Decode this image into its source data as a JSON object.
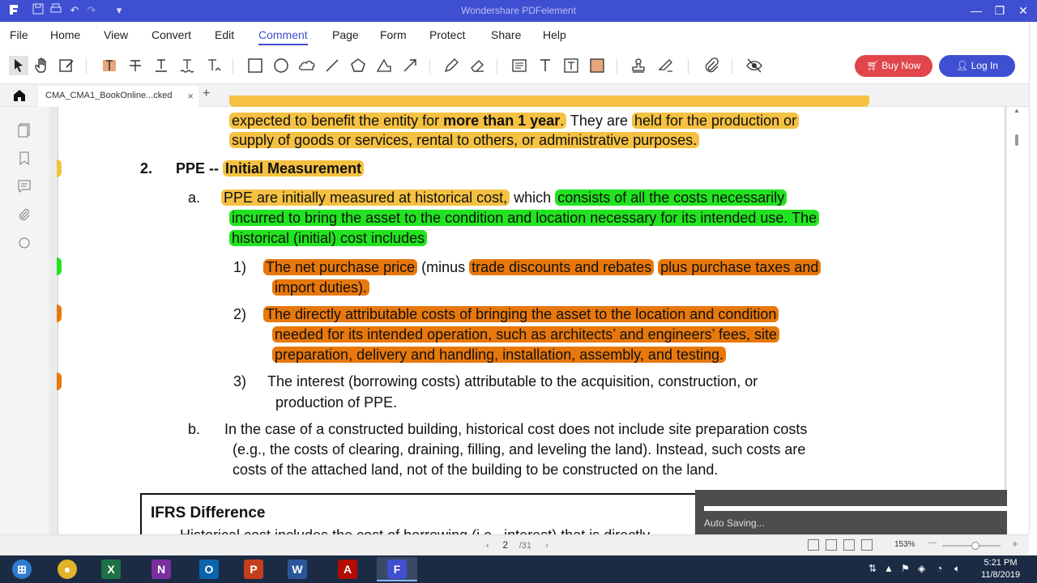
{
  "app": {
    "title": "Wondershare PDFelement"
  },
  "menu": [
    "File",
    "Home",
    "View",
    "Convert",
    "Edit",
    "Comment",
    "Page",
    "Form",
    "Protect",
    "Share",
    "Help"
  ],
  "menu_active": "Comment",
  "actions": {
    "buy_now": "Buy Now",
    "log_in": "Log In"
  },
  "tab": {
    "name": "CMA_CMA1_BookOnline...cked",
    "close": "×",
    "add": "+"
  },
  "doc": {
    "l0a": "expected to benefit the entity for ",
    "l0b": "more than 1 year",
    "l0c": ".",
    "l0d": " They are ",
    "l0e": "held for the production or",
    "l1": "supply of goods or services, rental to others, or administrative purposes.",
    "h2_num": "2.",
    "h2_a": "PPE -- ",
    "h2_b": "Initial Measurement",
    "a_label": "a.",
    "a1a": "PPE are initially measured at historical cost,",
    "a1b": " which ",
    "a1c": "consists of all the costs necessarily",
    "a2": "incurred to bring the asset to the condition and location necessary for its intended use. The",
    "a3": "historical (initial) cost includes",
    "i1_num": "1)",
    "i1a": "The net purchase price",
    "i1b": " (minus ",
    "i1c": "trade discounts and rebates",
    "i1d": " ",
    "i1e": "plus purchase taxes and",
    "i1f": "import duties).",
    "i2_num": "2)",
    "i2a": "The directly attributable costs of bringing the asset to the location and condition",
    "i2b": "needed for its intended operation, such as architects’ and engineers’ fees, site",
    "i2c": "preparation, delivery and handling, installation, assembly, and testing.",
    "i3_num": "3)",
    "i3a": "The interest (borrowing costs) attributable to the acquisition, construction, or",
    "i3b": "production of PPE.",
    "b_label": "b.",
    "b1": "In the case of a constructed building, historical cost does not include site preparation costs",
    "b2": "(e.g., the costs of clearing, draining, filling, and leveling the land). Instead, such costs are",
    "b3": "costs of the attached land, not of the building to be constructed on the land.",
    "ifrs_title": "IFRS Difference",
    "ifrs_cut": "Historical cost includes the cost of borrowing (i.e., interest) that is directly"
  },
  "autosave": "Auto Saving...",
  "status": {
    "page": "2",
    "total": "/31",
    "zoom": "153%",
    "prev": "‹",
    "next": "›",
    "zoom_out": "—",
    "zoom_in": "+"
  },
  "taskbar": {
    "time": "5:21 PM",
    "date": "11/8/2019"
  },
  "colors": {
    "brand": "#3f4fd1",
    "buy": "#e0464b",
    "hl_yellow": "#f5c142",
    "hl_green": "#21e31f",
    "hl_orange": "#e8780c"
  }
}
